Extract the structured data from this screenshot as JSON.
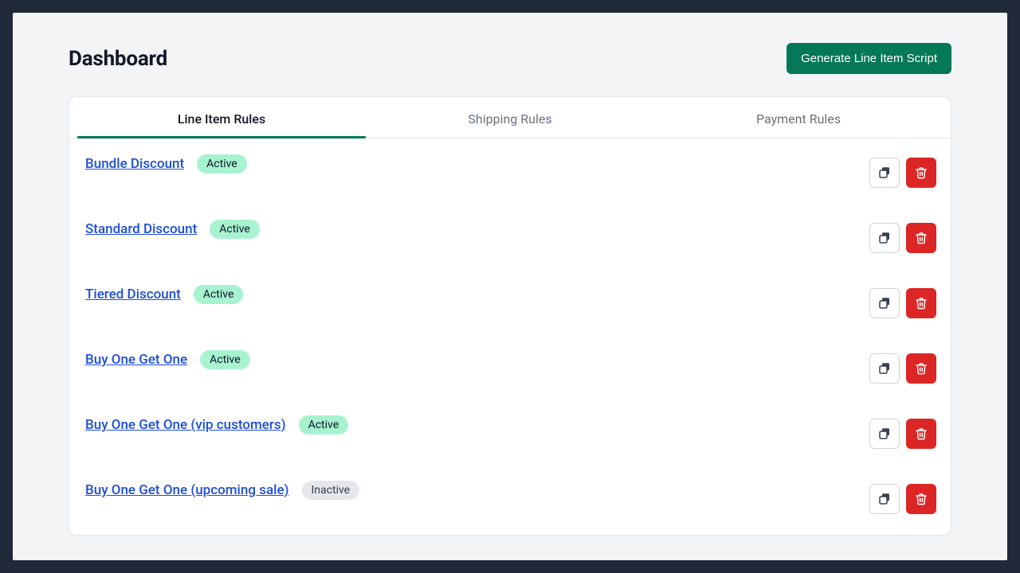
{
  "header": {
    "title": "Dashboard",
    "generate_button": "Generate Line Item Script"
  },
  "tabs": [
    {
      "label": "Line Item Rules",
      "active": true
    },
    {
      "label": "Shipping Rules",
      "active": false
    },
    {
      "label": "Payment Rules",
      "active": false
    }
  ],
  "status_labels": {
    "active": "Active",
    "inactive": "Inactive"
  },
  "rules": [
    {
      "name": "Bundle Discount",
      "status": "active"
    },
    {
      "name": "Standard Discount",
      "status": "active"
    },
    {
      "name": "Tiered Discount",
      "status": "active"
    },
    {
      "name": "Buy One Get One",
      "status": "active"
    },
    {
      "name": "Buy One Get One (vip customers)",
      "status": "active"
    },
    {
      "name": "Buy One Get One (upcoming sale)",
      "status": "inactive"
    }
  ]
}
